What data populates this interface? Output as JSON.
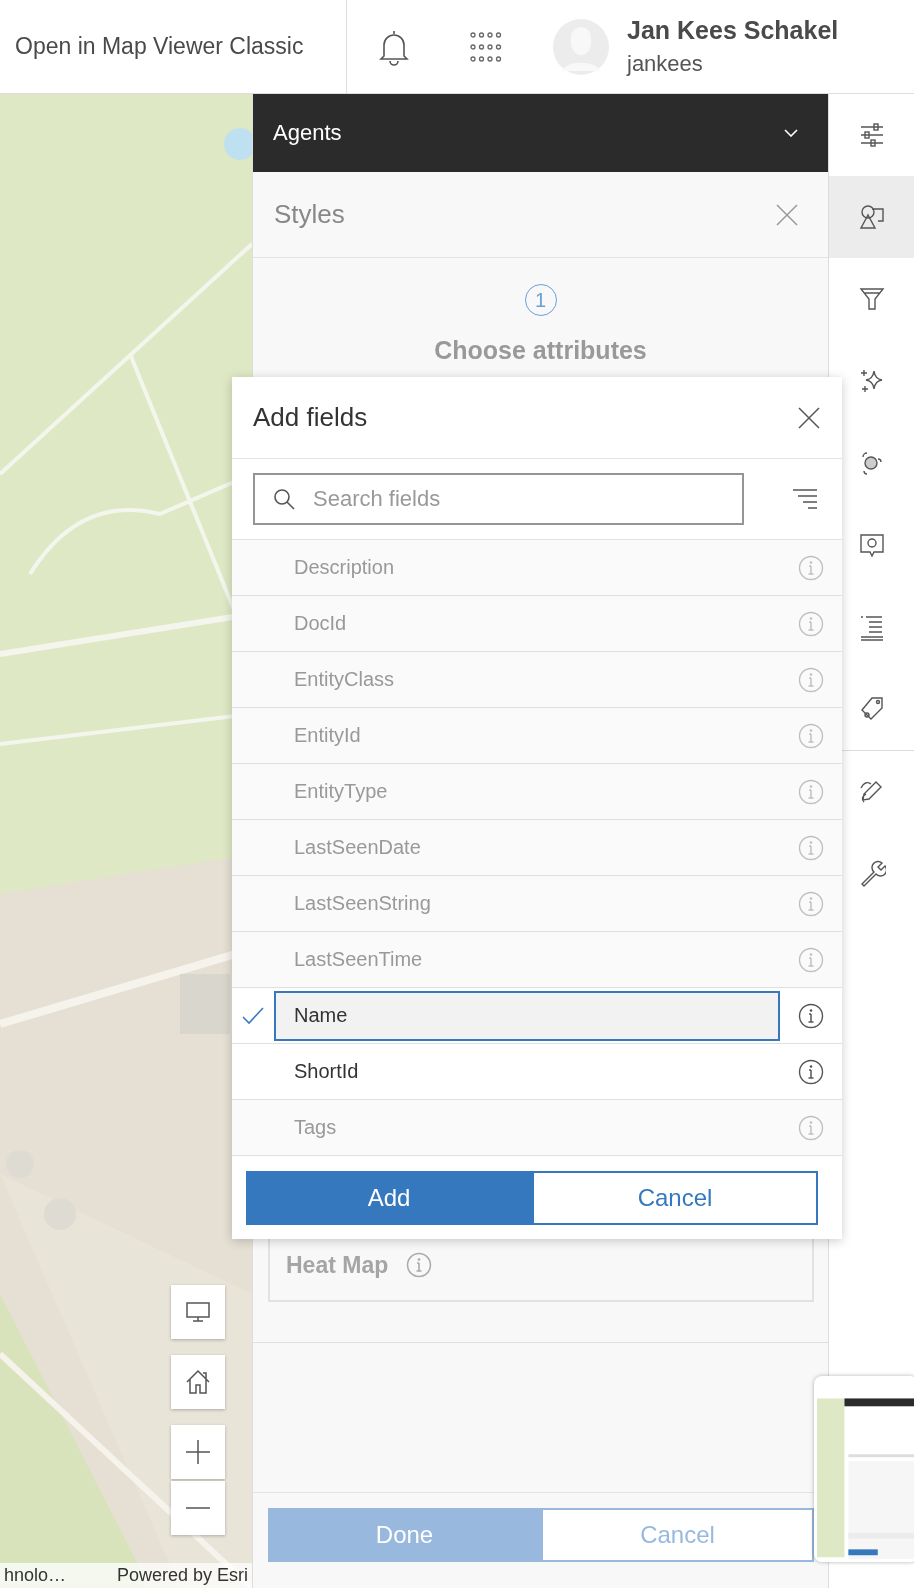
{
  "header": {
    "link": "Open in Map Viewer Classic",
    "user_name": "Jan Kees Schakel",
    "username": "jankees"
  },
  "map": {
    "attribution_left": "hnolo…",
    "attribution": "Powered by Esri"
  },
  "panel": {
    "layer": "Agents",
    "title": "Styles",
    "step": "1",
    "step_title": "Choose attributes",
    "style_card": "Heat Map",
    "buttons": [
      {
        "label": "Done",
        "kind": "primary",
        "disabled": true
      },
      {
        "label": "Cancel",
        "kind": "secondary",
        "disabled": true
      }
    ]
  },
  "rail": [
    {
      "selected": false
    },
    {
      "selected": true
    },
    {
      "selected": false
    },
    {
      "selected": false
    },
    {
      "selected": false
    },
    {
      "selected": false
    },
    {
      "selected": false
    },
    {
      "selected": false
    },
    {
      "selected": false
    },
    {
      "selected": false
    }
  ],
  "dialog": {
    "title": "Add fields",
    "search": {
      "placeholder": "Search fields"
    },
    "fields": [
      {
        "name": "Description",
        "disabled": true,
        "selected": false
      },
      {
        "name": "DocId",
        "disabled": true,
        "selected": false
      },
      {
        "name": "EntityClass",
        "disabled": true,
        "selected": false
      },
      {
        "name": "EntityId",
        "disabled": true,
        "selected": false
      },
      {
        "name": "EntityType",
        "disabled": true,
        "selected": false
      },
      {
        "name": "LastSeenDate",
        "disabled": true,
        "selected": false
      },
      {
        "name": "LastSeenString",
        "disabled": true,
        "selected": false
      },
      {
        "name": "LastSeenTime",
        "disabled": true,
        "selected": false
      },
      {
        "name": "Name",
        "disabled": false,
        "selected": true
      },
      {
        "name": "ShortId",
        "disabled": false,
        "selected": false
      },
      {
        "name": "Tags",
        "disabled": true,
        "selected": false
      }
    ],
    "buttons": [
      {
        "label": "Add",
        "kind": "primary"
      },
      {
        "label": "Cancel",
        "kind": "secondary"
      }
    ]
  }
}
